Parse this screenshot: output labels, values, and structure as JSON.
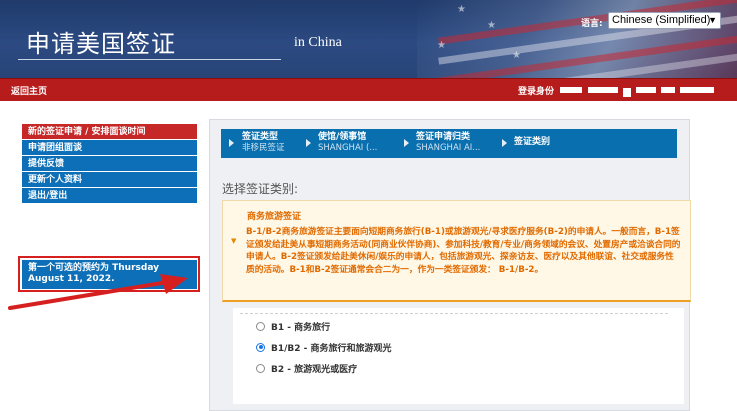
{
  "header": {
    "title": "申请美国签证",
    "subtitle": "in China",
    "language_label": "语言:",
    "language_selected": "Chinese (Simplified)"
  },
  "topbar": {
    "home_link": "返回主页",
    "login_label": "登录身份"
  },
  "sidebar": {
    "items": [
      {
        "label": "新的签证申请 / 安排面谈时间",
        "active": true
      },
      {
        "label": "申请团组面谈",
        "active": false
      },
      {
        "label": "提供反馈",
        "active": false
      },
      {
        "label": "更新个人资料",
        "active": false
      },
      {
        "label": "退出/登出",
        "active": false
      }
    ],
    "appointment_notice": "第一个可选的预约为 Thursday August 11, 2022."
  },
  "steps": [
    {
      "name": "签证类型",
      "value": "非移民签证"
    },
    {
      "name": "使馆/领事馆",
      "value": "SHANGHAI (..."
    },
    {
      "name": "签证申请归类",
      "value": "SHANGHAI AI..."
    },
    {
      "name": "签证类别",
      "value": ""
    }
  ],
  "main": {
    "section_title": "选择签证类别:",
    "info_title": "商务旅游签证",
    "info_text": "B-1/B-2商务旅游签证主要面向短期商务旅行(B-1)或旅游观光/寻求医疗服务(B-2)的申请人。一般而言，B-1签证颁发给赴美从事短期商务活动(同商业伙伴协商)、参加科技/教育/专业/商务领域的会议、处置房产或洽谈合同的申请人。B-2签证颁发给赴美休闲/娱乐的申请人，包括旅游观光、探亲访友、医疗以及其他联谊、社交或服务性质的活动。B-1和B-2签证通常会合二为一，作为一类签证颁发： B-1/B-2。",
    "options": [
      {
        "label": "B1 - 商务旅行",
        "checked": false
      },
      {
        "label": "B1/B2 - 商务旅行和旅游观光",
        "checked": true
      },
      {
        "label": "B2 - 旅游观光或医疗",
        "checked": false
      }
    ]
  },
  "colors": {
    "header_blue": "#284477",
    "red_bar": "#b71c1c",
    "sidebar_blue": "#0c6fb8",
    "active_red": "#c62828",
    "info_orange": "#e06a00"
  }
}
